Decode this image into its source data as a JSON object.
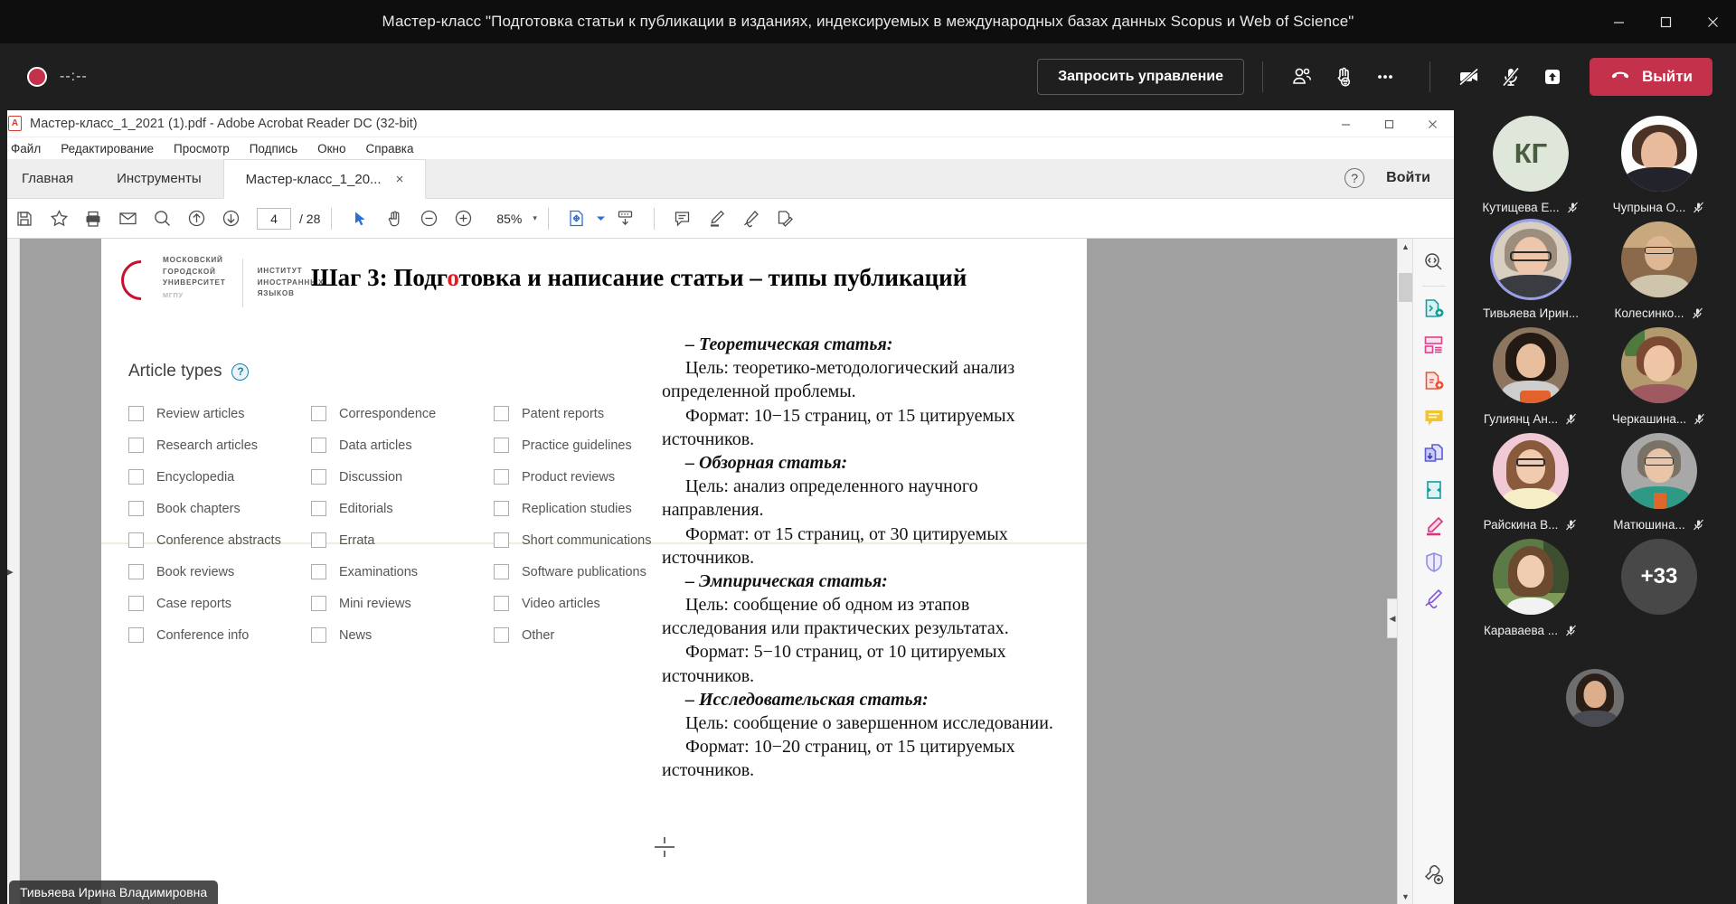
{
  "teams": {
    "window_title": "Мастер-класс \"Подготовка статьи к публикации в изданиях, индексируемых в международных базах данных Scopus и Web of Science\"",
    "recording_timer": "--:--",
    "request_control_label": "Запросить управление",
    "leave_label": "Выйти",
    "icons": {
      "minimize": "minimize-icon",
      "maximize": "maximize-icon",
      "close": "close-icon",
      "participants": "people-icon",
      "reactions": "raise-hand-icon",
      "more": "more-options-icon",
      "camera": "camera-off-icon",
      "mic": "mic-off-icon",
      "share": "share-screen-icon",
      "hangup": "hangup-icon"
    }
  },
  "acrobat": {
    "title": "Мастер-класс_1_2021 (1).pdf - Adobe Acrobat Reader DC (32-bit)",
    "menu": [
      "Файл",
      "Редактирование",
      "Просмотр",
      "Подпись",
      "Окно",
      "Справка"
    ],
    "tabs": [
      {
        "label": "Главная",
        "active": false
      },
      {
        "label": "Инструменты",
        "active": false
      },
      {
        "label": "Мастер-класс_1_20...",
        "active": true
      }
    ],
    "tab_close": "×",
    "sign_in": "Войти",
    "help_glyph": "?",
    "toolbar": {
      "page_current": "4",
      "page_total": "/ 28",
      "zoom": "85%",
      "zoom_caret": "▾"
    }
  },
  "slide": {
    "logo": {
      "line1": "МОСКОВСКИЙ",
      "line2": "ГОРОДСКОЙ",
      "line3": "УНИВЕРСИТЕТ",
      "abbr": "МГПУ",
      "inst1": "ИНСТИТУТ",
      "inst2": "ИНОСТРАННЫХ",
      "inst3": "ЯЗЫКОВ"
    },
    "title_before": "Шаг 3: Подг",
    "title_red": "о",
    "title_after": "товка и написание статьи – типы публикаций",
    "article_types": {
      "heading": "Article types",
      "help": "?",
      "columns": [
        [
          "Review articles",
          "Research articles",
          "Encyclopedia",
          "Book chapters",
          "Conference abstracts",
          "Book reviews",
          "Case reports",
          "Conference info"
        ],
        [
          "Correspondence",
          "Data articles",
          "Discussion",
          "Editorials",
          "Errata",
          "Examinations",
          "Mini reviews",
          "News"
        ],
        [
          "Patent reports",
          "Practice guidelines",
          "Product reviews",
          "Replication studies",
          "Short communications",
          "Software publications",
          "Video articles",
          "Other"
        ]
      ]
    },
    "text_blocks": [
      {
        "head": "– Теоретическая статья:",
        "lines": [
          "Цель: теоретико-методологический анализ определенной проблемы.",
          "Формат: 10−15 страниц, от 15 цитируемых источников."
        ]
      },
      {
        "head": "– Обзорная статья:",
        "lines": [
          "Цель: анализ определенного научного направления.",
          "Формат: от 15 страниц, от 30 цитируемых источников."
        ]
      },
      {
        "head": "– Эмпирическая статья:",
        "lines": [
          "Цель: сообщение об одном из этапов исследования или практических результатах.",
          "Формат: 5−10 страниц, от 10 цитируемых источников."
        ]
      },
      {
        "head": "– Исследовательская статья:",
        "lines": [
          "Цель: сообщение о завершенном исследовании.",
          "Формат: 10−20 страниц, от 15 цитируемых источников."
        ]
      }
    ]
  },
  "presenter_tag": "Тивьяева Ирина Владимировна",
  "roster": {
    "participants": [
      {
        "name": "Кутищева Е...",
        "initials": "КГ",
        "muted": true,
        "speaking": false,
        "photo": false
      },
      {
        "name": "Чупрына О...",
        "muted": true,
        "speaking": false,
        "photo": true
      },
      {
        "name": "Тивьяева Ирин...",
        "muted": false,
        "speaking": true,
        "photo": true
      },
      {
        "name": "Колесинко...",
        "muted": true,
        "speaking": false,
        "photo": true
      },
      {
        "name": "Гулиянц Ан...",
        "muted": true,
        "speaking": false,
        "photo": true
      },
      {
        "name": "Черкашина...",
        "muted": true,
        "speaking": false,
        "photo": true
      },
      {
        "name": "Райскина В...",
        "muted": true,
        "speaking": false,
        "photo": true
      },
      {
        "name": "Матюшина...",
        "muted": true,
        "speaking": false,
        "photo": true
      },
      {
        "name": "Караваева ...",
        "muted": true,
        "speaking": false,
        "photo": true
      }
    ],
    "overflow_label": "+33"
  },
  "colors": {
    "teams_bg": "#1f1f1f",
    "teams_titlebar": "#0e0e0e",
    "leave_red": "#c4314b",
    "recording_red": "#c4314b",
    "speaking_ring": "#9aa0e8",
    "title_accent_red": "#e01b24",
    "logo_red": "#c8102e",
    "help_blue": "#1b7fa8"
  }
}
